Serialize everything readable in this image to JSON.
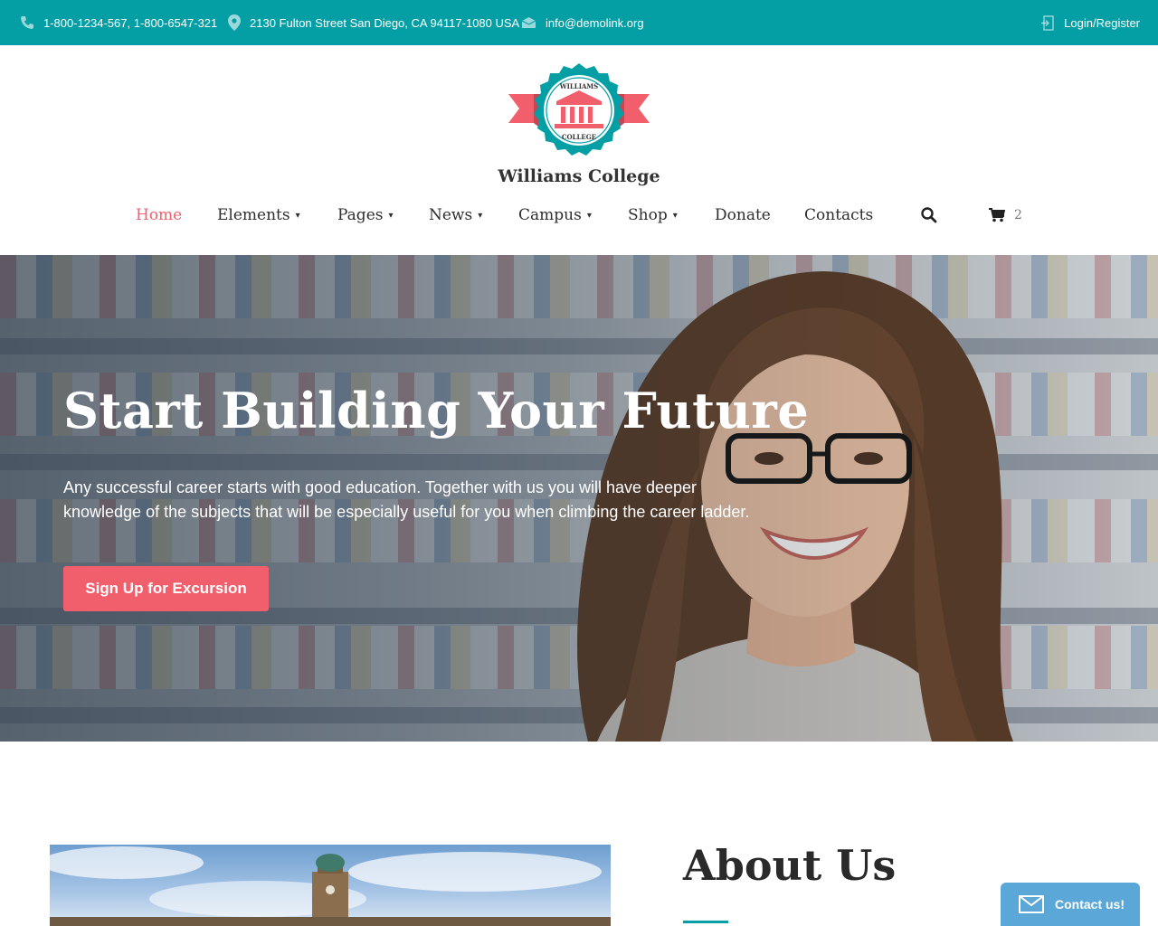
{
  "topbar": {
    "phone": "1-800-1234-567, 1-800-6547-321",
    "address": "2130 Fulton Street San Diego, CA 94117-1080 USA",
    "email": "info@demolink.org",
    "login": "Login/Register",
    "icons": [
      "phone-icon",
      "map-pin-icon",
      "envelope-icon",
      "login-icon"
    ]
  },
  "logo": {
    "top_text": "WILLIAMS",
    "bottom_text": "COLLEGE",
    "colors": {
      "teal": "#049fa5",
      "coral": "#f15f6c"
    }
  },
  "site_name": "Williams College",
  "nav": {
    "items": [
      {
        "label": "Home"
      },
      {
        "label": "Elements"
      },
      {
        "label": "Pages"
      },
      {
        "label": "News"
      },
      {
        "label": "Campus"
      },
      {
        "label": "Shop"
      },
      {
        "label": "Donate"
      },
      {
        "label": "Contacts"
      }
    ],
    "cart_count": "2",
    "active_color": "#f15f6c"
  },
  "hero": {
    "title": "Start Building Your Future",
    "text": "Any successful career starts with good education. Together with us you will have deeper knowledge of the subjects that will be especially useful for you when climbing the career ladder.",
    "cta": "Sign Up for Excursion"
  },
  "about": {
    "title": "About Us"
  },
  "contact_widget": {
    "label": "Contact us!"
  }
}
